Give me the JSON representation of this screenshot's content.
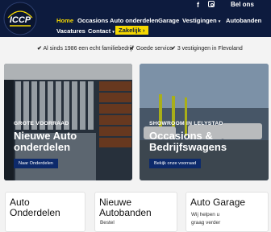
{
  "header": {
    "logo_text": "ICCP",
    "social": {
      "facebook": "f",
      "instagram": "instagram-icon"
    },
    "phone_label": "Bel ons",
    "nav": [
      {
        "label": "Home",
        "active": true
      },
      {
        "label": "Occasions"
      },
      {
        "label": "Auto onderdelen"
      },
      {
        "label": "Garage"
      },
      {
        "label": "Vestigingen"
      },
      {
        "label": "Autobanden"
      },
      {
        "label": "Vacatures"
      },
      {
        "label": "Contact"
      }
    ],
    "dropdown_caret": "▾",
    "zakelijk": {
      "label": "Zakelijk",
      "caret": "›"
    }
  },
  "usps": [
    {
      "check": "✔",
      "text": "Al sinds 1986 een echt familiebedrijf"
    },
    {
      "check": "✔",
      "text": "Goede service"
    },
    {
      "check": "✔",
      "text": "3 vestigingen in Flevoland"
    }
  ],
  "cards": [
    {
      "kicker": "GROTE VOORRAAD",
      "title_line1": "Nieuwe Auto",
      "title_line2": "onderdelen",
      "button": "Naar Onderdelen"
    },
    {
      "kicker": "SHOWROOM IN LELYSTAD",
      "title_line1": "Occasions &",
      "title_line2": "Bedrijfswagens",
      "button": "Bekijk onze voorraad"
    }
  ],
  "bottom_cards": [
    {
      "title_line1": "Auto",
      "title_line2": "Onderdelen"
    },
    {
      "title_line1": "Nieuwe",
      "title_line2": "Autobanden",
      "sub": "Bestel"
    },
    {
      "title_line1": "Auto Garage",
      "sub1": "Wij helpen u",
      "sub2": "graag verder"
    }
  ],
  "colors": {
    "navy": "#0d1b3e",
    "yellow": "#f5d800",
    "button_blue": "#0d2a6b"
  }
}
